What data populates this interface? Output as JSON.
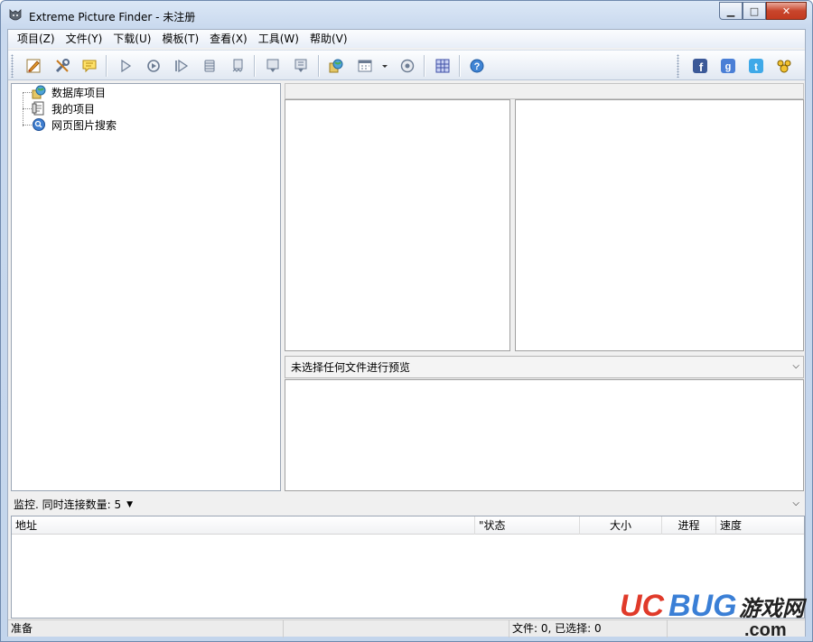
{
  "window": {
    "title": "Extreme Picture Finder - 未注册",
    "caption_buttons": {
      "minimize": "▁",
      "maximize": "□",
      "close": "✕"
    }
  },
  "menu": [
    {
      "label": "项目(Z)"
    },
    {
      "label": "文件(Y)"
    },
    {
      "label": "下载(U)"
    },
    {
      "label": "模板(T)"
    },
    {
      "label": "查看(X)"
    },
    {
      "label": "工具(W)"
    },
    {
      "label": "帮助(V)"
    }
  ],
  "toolbar": {
    "buttons": [
      "edit-icon",
      "tools-icon",
      "comment-icon",
      "play-icon",
      "refresh-play-icon",
      "step-play-icon",
      "stop-icon",
      "stop-all-icon",
      "download-icon",
      "download-alt-icon",
      "globe-icon",
      "calendar-icon",
      "settings-icon",
      "grid-icon",
      "help-icon"
    ],
    "social": [
      "facebook-icon",
      "google-plus-icon",
      "twitter-icon",
      "community-icon"
    ]
  },
  "tree": {
    "items": [
      {
        "label": "数据库项目",
        "icon": "globe-folder-icon"
      },
      {
        "label": "我的项目",
        "icon": "document-icon"
      },
      {
        "label": "网页图片搜索",
        "icon": "search-globe-icon"
      }
    ]
  },
  "preview": {
    "label": "未选择任何文件进行预览"
  },
  "monitor": {
    "label": "监控. 同时连接数量: 5"
  },
  "download_list": {
    "columns": [
      "地址",
      "\"状态",
      "大小",
      "进程",
      "速度"
    ]
  },
  "status": {
    "ready": "准备",
    "files": "文件: 0, 已选择: 0"
  },
  "watermark": {
    "brand_a": "UC",
    "brand_b": "BUG",
    "cn": "游戏网",
    "domain": ".com"
  }
}
